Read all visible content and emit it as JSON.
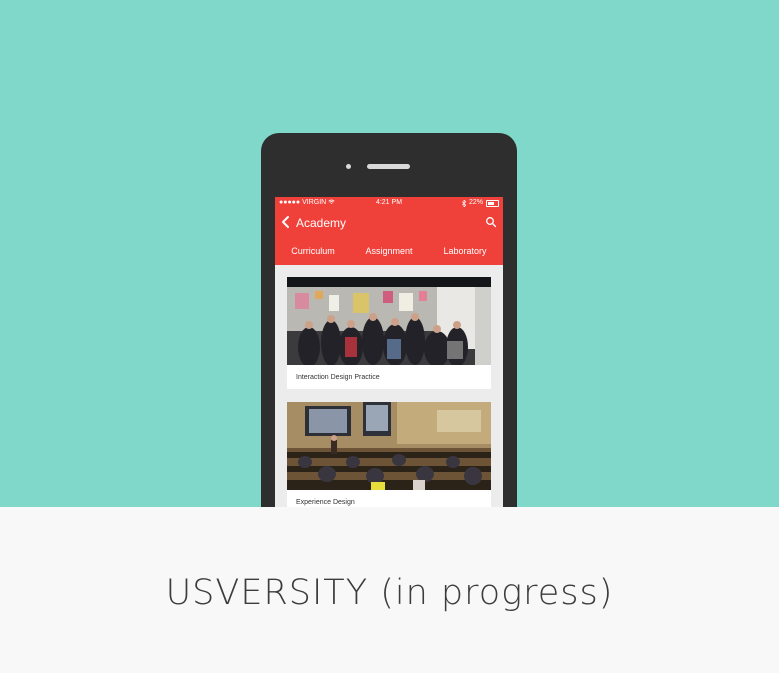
{
  "status_bar": {
    "carrier": "●●●●● VIRGIN",
    "time": "4:21 PM",
    "battery": "22%"
  },
  "app_bar": {
    "title": "Academy",
    "back_icon": "chevron-left-icon",
    "search_icon": "search-icon"
  },
  "tabs": [
    {
      "label": "Curriculum"
    },
    {
      "label": "Assignment"
    },
    {
      "label": "Laboratory"
    }
  ],
  "cards": [
    {
      "label": "Interaction Design Practice"
    },
    {
      "label": "Experience Design"
    }
  ],
  "caption": "USVERSITY (in progress)",
  "colors": {
    "background_teal": "#7fd8c9",
    "app_red": "#f0403a",
    "phone_body": "#2e2e2e",
    "caption_text": "#3c3c3c"
  }
}
